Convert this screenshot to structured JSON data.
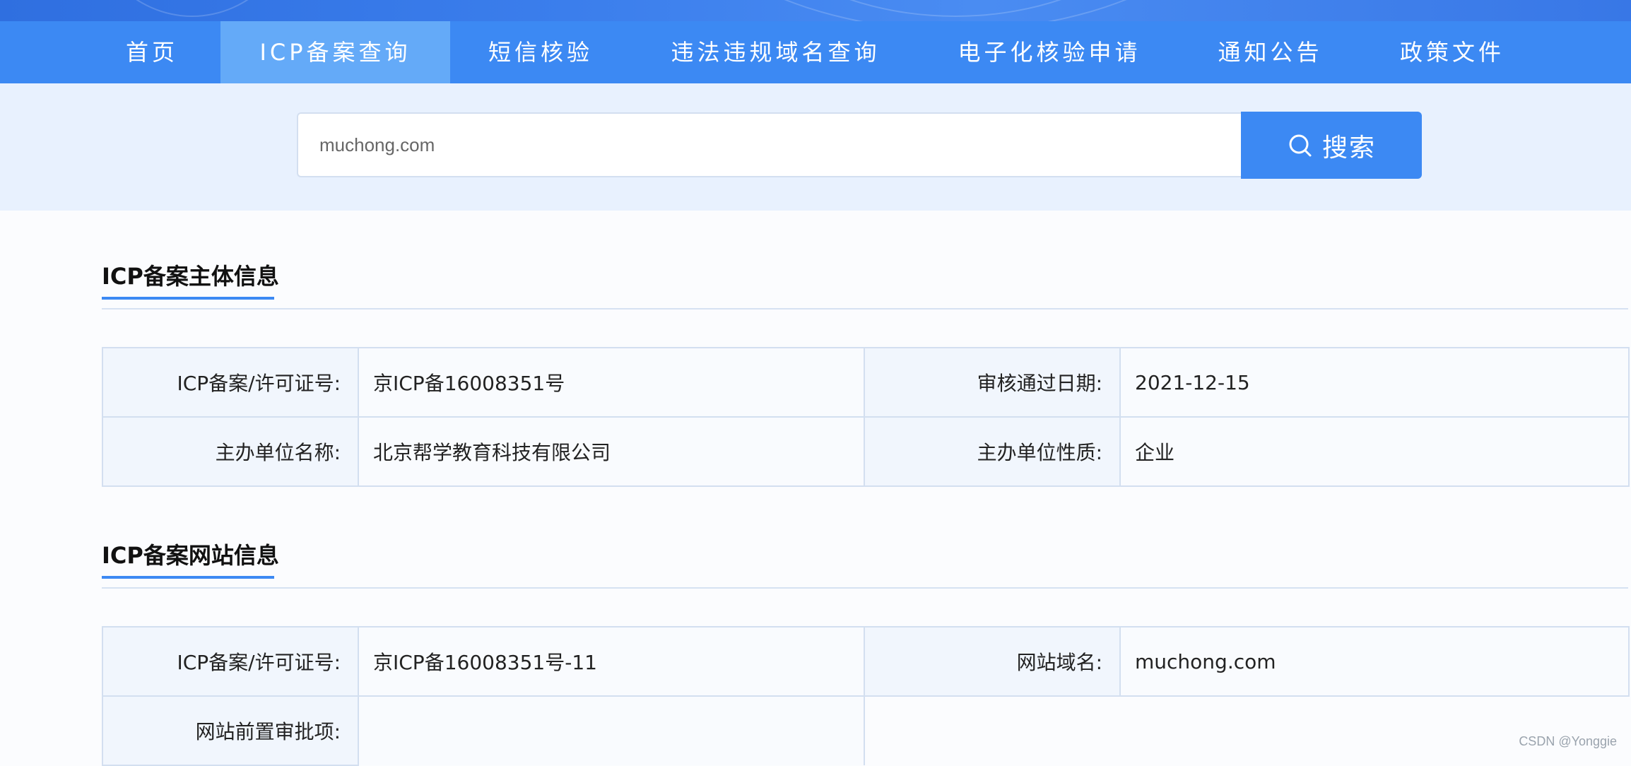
{
  "nav": {
    "items": [
      {
        "label": "首页"
      },
      {
        "label": "ICP备案查询"
      },
      {
        "label": "短信核验"
      },
      {
        "label": "违法违规域名查询"
      },
      {
        "label": "电子化核验申请"
      },
      {
        "label": "通知公告"
      },
      {
        "label": "政策文件"
      }
    ],
    "active": "ICP备案查询"
  },
  "search": {
    "value": "muchong.com",
    "button_label": "搜索",
    "button_icon": "search-icon"
  },
  "subject_section": {
    "title": "ICP备案主体信息",
    "rows": [
      {
        "label_left": "ICP备案/许可证号:",
        "value_left": "京ICP备16008351号",
        "label_right": "审核通过日期:",
        "value_right": "2021-12-15"
      },
      {
        "label_left": "主办单位名称:",
        "value_left": "北京帮学教育科技有限公司",
        "label_right": "主办单位性质:",
        "value_right": "企业"
      }
    ]
  },
  "website_section": {
    "title": "ICP备案网站信息",
    "rows": [
      {
        "label_left": "ICP备案/许可证号:",
        "value_left": "京ICP备16008351号-11",
        "label_right": "网站域名:",
        "value_right": "muchong.com"
      },
      {
        "label_left": "网站前置审批项:",
        "value_left": ""
      }
    ]
  },
  "watermark": "CSDN @Yonggie",
  "colors": {
    "nav_bg": "#3c89f3",
    "nav_active_bg": "#64aaf8",
    "search_band_bg": "#e8f1fe",
    "accent": "#3c89f3",
    "table_border": "#d3dff0",
    "label_cell_bg": "#f1f6fd"
  }
}
